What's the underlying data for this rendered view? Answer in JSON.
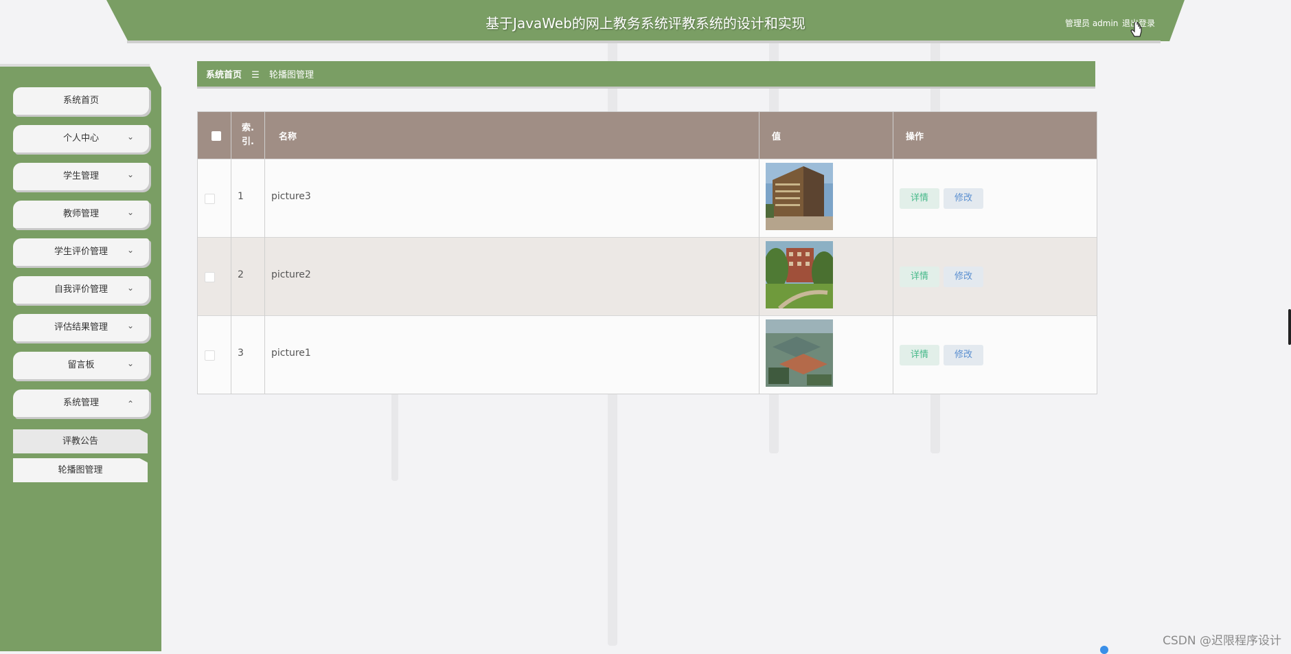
{
  "header": {
    "title": "基于JavaWeb的网上教务系统评教系统的设计和实现",
    "user_label": "管理员 admin",
    "logout_label": "退出登录"
  },
  "sidebar": {
    "items": [
      {
        "label": "系统首页",
        "chevron": ""
      },
      {
        "label": "个人中心",
        "chevron": "⌄"
      },
      {
        "label": "学生管理",
        "chevron": "⌄"
      },
      {
        "label": "教师管理",
        "chevron": "⌄"
      },
      {
        "label": "学生评价管理",
        "chevron": "⌄"
      },
      {
        "label": "自我评价管理",
        "chevron": "⌄"
      },
      {
        "label": "评估结果管理",
        "chevron": "⌄"
      },
      {
        "label": "留言板",
        "chevron": "⌄"
      },
      {
        "label": "系统管理",
        "chevron": "⌃"
      }
    ],
    "sub_items": [
      {
        "label": "评教公告"
      },
      {
        "label": "轮播图管理"
      }
    ]
  },
  "breadcrumb": {
    "home": "系统首页",
    "separator": "☰",
    "current": "轮播图管理"
  },
  "table": {
    "headers": {
      "index": "索.引.",
      "name": "名称",
      "value": "值",
      "actions": "操作"
    },
    "rows": [
      {
        "index": "1",
        "name": "picture3",
        "detail": "详情",
        "edit": "修改"
      },
      {
        "index": "2",
        "name": "picture2",
        "detail": "详情",
        "edit": "修改"
      },
      {
        "index": "3",
        "name": "picture1",
        "detail": "详情",
        "edit": "修改"
      }
    ]
  },
  "watermark": "CSDN @迟限程序设计",
  "colors": {
    "accent_green": "#7a9e64",
    "table_header": "#a08e85",
    "detail_text": "#47b98a",
    "edit_text": "#5a8fd0"
  }
}
